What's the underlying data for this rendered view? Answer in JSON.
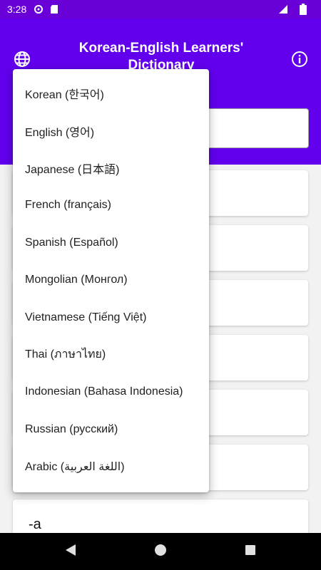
{
  "status_bar": {
    "time": "3:28"
  },
  "app_bar": {
    "title": "Korean-English Learners' Dictionary"
  },
  "language_menu": {
    "items": [
      "Korean (한국어)",
      "English (영어)",
      "Japanese (日本語)",
      "French (français)",
      "Spanish (Español)",
      "Mongolian (Монгол)",
      "Vietnamese (Tiếng Việt)",
      "Thai (ภาษาไทย)",
      "Indonesian (Bahasa Indonesia)",
      "Russian (русский)",
      "Arabic (اللغة العربية)"
    ]
  },
  "word_list": {
    "visible_word": "-a"
  },
  "colors": {
    "app_bar": "#6200ee",
    "status_bar": "#6a00d8",
    "background": "#f2f2f2"
  }
}
